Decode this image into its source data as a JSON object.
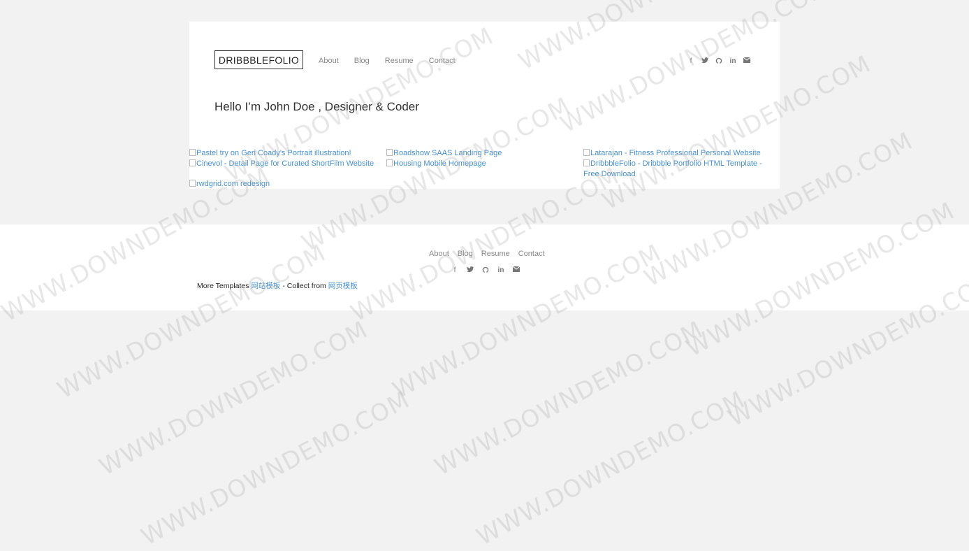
{
  "brand": "DRIBBBLEFOLIO",
  "nav": [
    "About",
    "Blog",
    "Resume",
    "Contact"
  ],
  "social_icons": [
    "facebook-icon",
    "twitter-icon",
    "github-icon",
    "linkedin-icon",
    "email-icon"
  ],
  "hero": "Hello I’m John Doe , Designer & Coder",
  "portfolio": [
    "Pastel try on Geri Coady's Portrait illustration!",
    "Roadshow SAAS Landing Page",
    "Latarajan - Fitness Professional Personal Website",
    "Cinevol - Detail Page for Curated ShortFilm Website",
    "Housing Mobile Homepage",
    "DribbbleFolio - Dribbble Portfolio HTML Template - Free Download",
    "rwdgrid.com redesign"
  ],
  "footer": {
    "nav": [
      "About",
      "Blog",
      "Resume",
      "Contact"
    ],
    "credit_prefix": "More Templates",
    "credit_link1": "网站模板",
    "credit_mid": "- Collect from",
    "credit_link2": "网页模板"
  },
  "watermark": "WWW.DOWNDEMO.COM",
  "colors": {
    "link": "#4a90c8",
    "background": "#f2f2f2",
    "card": "#ffffff"
  }
}
